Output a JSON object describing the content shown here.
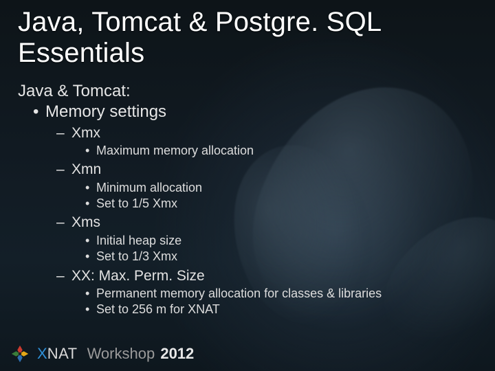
{
  "title_line1": "Java, Tomcat & Postgre. SQL",
  "title_line2": "Essentials",
  "section": "Java & Tomcat:",
  "bullet1": "Memory settings",
  "params": [
    {
      "name": "Xmx",
      "notes": [
        "Maximum memory allocation"
      ]
    },
    {
      "name": "Xmn",
      "notes": [
        "Minimum allocation",
        "Set to 1/5 Xmx"
      ]
    },
    {
      "name": "Xms",
      "notes": [
        "Initial heap size",
        "Set to 1/3 Xmx"
      ]
    },
    {
      "name": "XX: Max. Perm. Size",
      "notes": [
        "Permanent memory allocation for classes & libraries",
        "Set to 256 m for XNAT"
      ]
    }
  ],
  "footer": {
    "brand_x": "X",
    "brand_nat": "NAT",
    "workshop": "Workshop",
    "year": "2012"
  },
  "glyphs": {
    "bullet": "•",
    "dash": "–"
  }
}
